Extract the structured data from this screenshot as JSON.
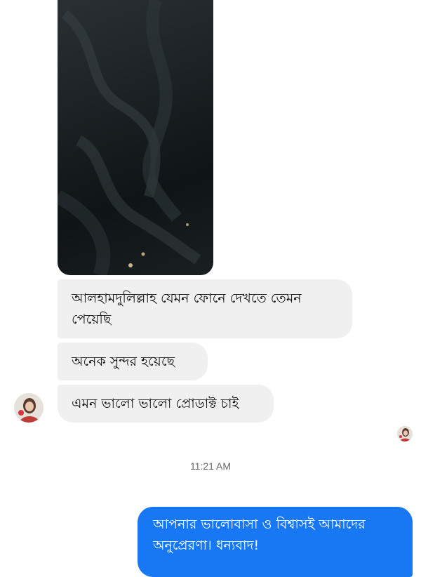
{
  "conversation": {
    "image_message": {
      "icon": "photo-attachment"
    },
    "incoming_messages": [
      {
        "text": "আলহামদুলিল্লাহ যেমন ফোনে দেখতে তেমন পেয়েছি"
      },
      {
        "text": "অনেক সুন্দর হয়েছে"
      },
      {
        "text": "এমন ভালো ভালো প্রোডাক্ট চাই"
      }
    ],
    "timestamp": "11:21 AM",
    "outgoing_messages": [
      {
        "text": "আপনার ভালোবাসা ও বিশ্বাসই আমাদের অনুপ্রেরণা। ধন্যবাদ!"
      }
    ]
  },
  "colors": {
    "incoming_bubble": "#f1f0f0",
    "outgoing_bubble": "#1877f2",
    "timestamp_text": "#65676b"
  }
}
